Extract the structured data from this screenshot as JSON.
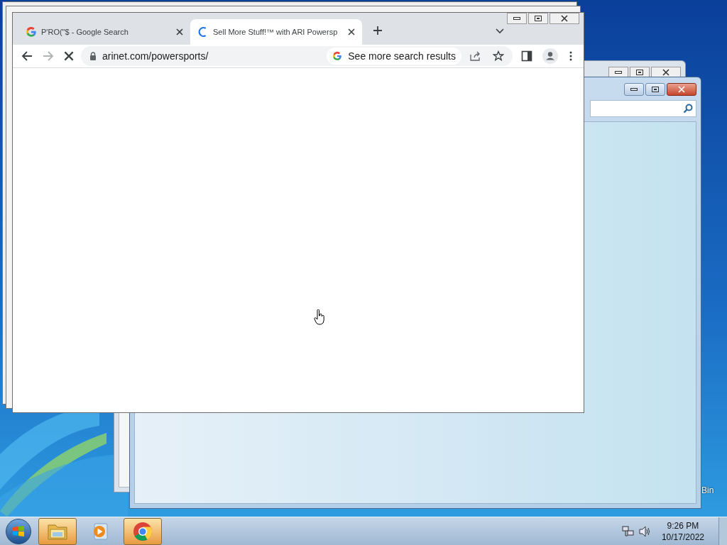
{
  "browser": {
    "tabs": [
      {
        "title": "P'RO(\"$ - Google Search",
        "selected": false,
        "loading": false
      },
      {
        "title": "Sell More Stuff!™ with ARI Powersp",
        "selected": true,
        "loading": true
      }
    ],
    "address": "arinet.com/powersports/",
    "search_chip": "See more search results",
    "loading": true
  },
  "desktop_icons": [
    {
      "label": "Bin"
    }
  ],
  "taskbar": {
    "items": [
      {
        "kind": "explorer",
        "running": true
      },
      {
        "kind": "media",
        "running": false
      },
      {
        "kind": "chrome",
        "running": true
      }
    ],
    "time": "9:26 PM",
    "date": "10/17/2022"
  }
}
